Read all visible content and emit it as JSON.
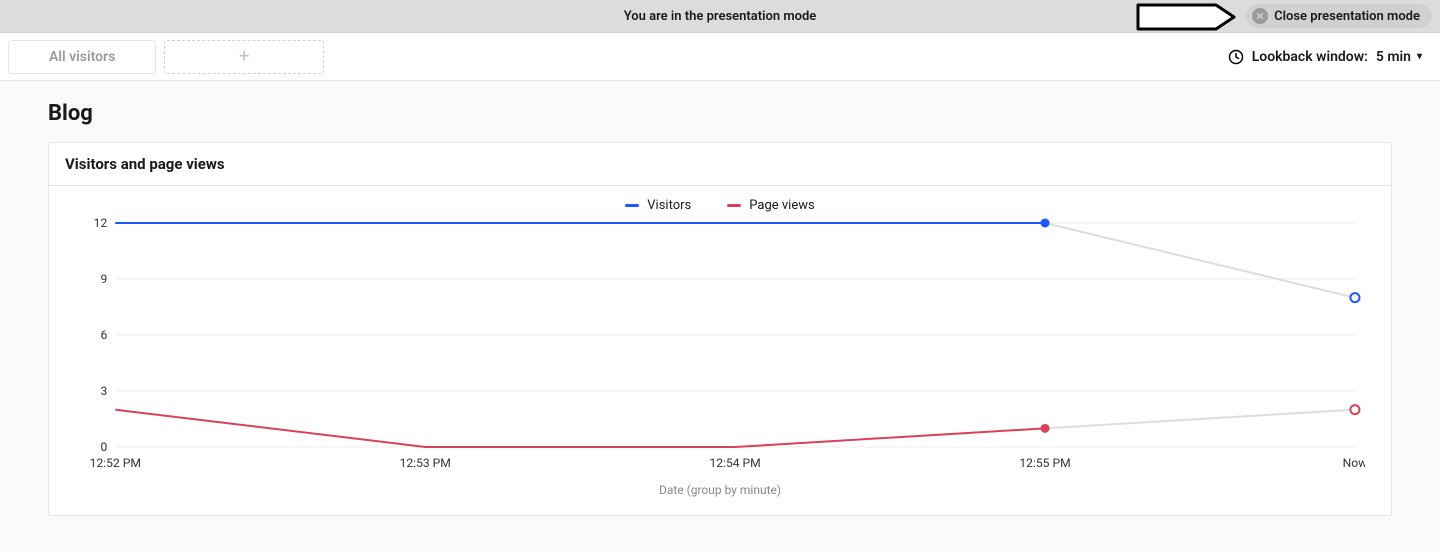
{
  "banner": {
    "message": "You are in the presentation mode",
    "close_label": "Close presentation mode"
  },
  "tabs": {
    "items": [
      {
        "label": "All visitors"
      }
    ]
  },
  "lookback": {
    "label": "Lookback window:",
    "value": "5 min"
  },
  "page": {
    "title": "Blog"
  },
  "card": {
    "title": "Visitors and page views"
  },
  "chart_data": {
    "type": "line",
    "title": "Visitors and page views",
    "xlabel": "Date (group by minute)",
    "ylabel": "",
    "ylim": [
      0,
      12
    ],
    "yticks": [
      0,
      3,
      6,
      9,
      12
    ],
    "categories": [
      "12:52 PM",
      "12:53 PM",
      "12:54 PM",
      "12:55 PM",
      "Now"
    ],
    "series": [
      {
        "name": "Visitors",
        "color": "#1f57ff",
        "values": [
          12,
          12,
          12,
          12,
          8
        ],
        "last_open": true
      },
      {
        "name": "Page views",
        "color": "#d9415b",
        "values": [
          2,
          0,
          0,
          1,
          2
        ],
        "last_open": true
      }
    ],
    "legend": [
      {
        "label": "Visitors",
        "color": "#1f57ff"
      },
      {
        "label": "Page views",
        "color": "#d9415b"
      }
    ]
  }
}
